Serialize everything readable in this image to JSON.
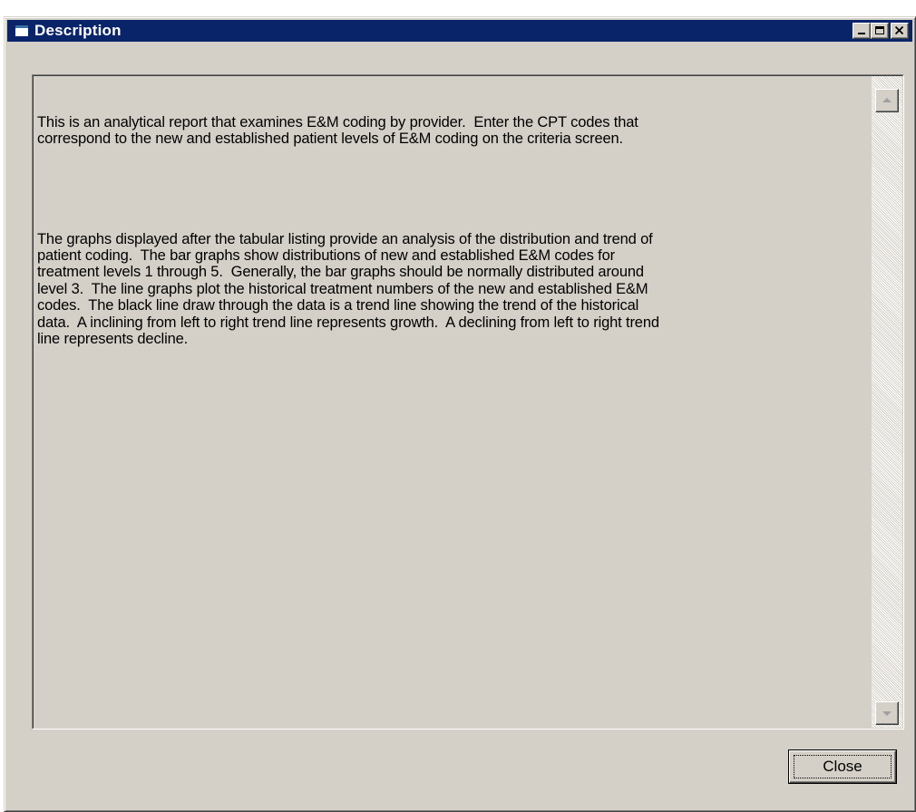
{
  "window": {
    "title": "Description",
    "colors": {
      "titlebar": "#0a246a",
      "face": "#d4d0c8"
    }
  },
  "title_buttons": {
    "minimize_icon": "minimize-icon",
    "maximize_icon": "maximize-icon",
    "close_icon": "close-icon"
  },
  "description": {
    "paragraphs": [
      "This is an analytical report that examines E&M coding by provider.  Enter the CPT codes that\ncorrespond to the new and established patient levels of E&M coding on the criteria screen.",
      "The graphs displayed after the tabular listing provide an analysis of the distribution and trend of\npatient coding.  The bar graphs show distributions of new and established E&M codes for\ntreatment levels 1 through 5.  Generally, the bar graphs should be normally distributed around\nlevel 3.  The line graphs plot the historical treatment numbers of the new and established E&M\ncodes.  The black line draw through the data is a trend line showing the trend of the historical\ndata.  A inclining from left to right trend line represents growth.  A declining from left to right trend\nline represents decline."
    ]
  },
  "scrollbar": {
    "up_icon": "scroll-up-arrow-icon",
    "down_icon": "scroll-down-arrow-icon"
  },
  "buttons": {
    "close_label": "Close"
  }
}
